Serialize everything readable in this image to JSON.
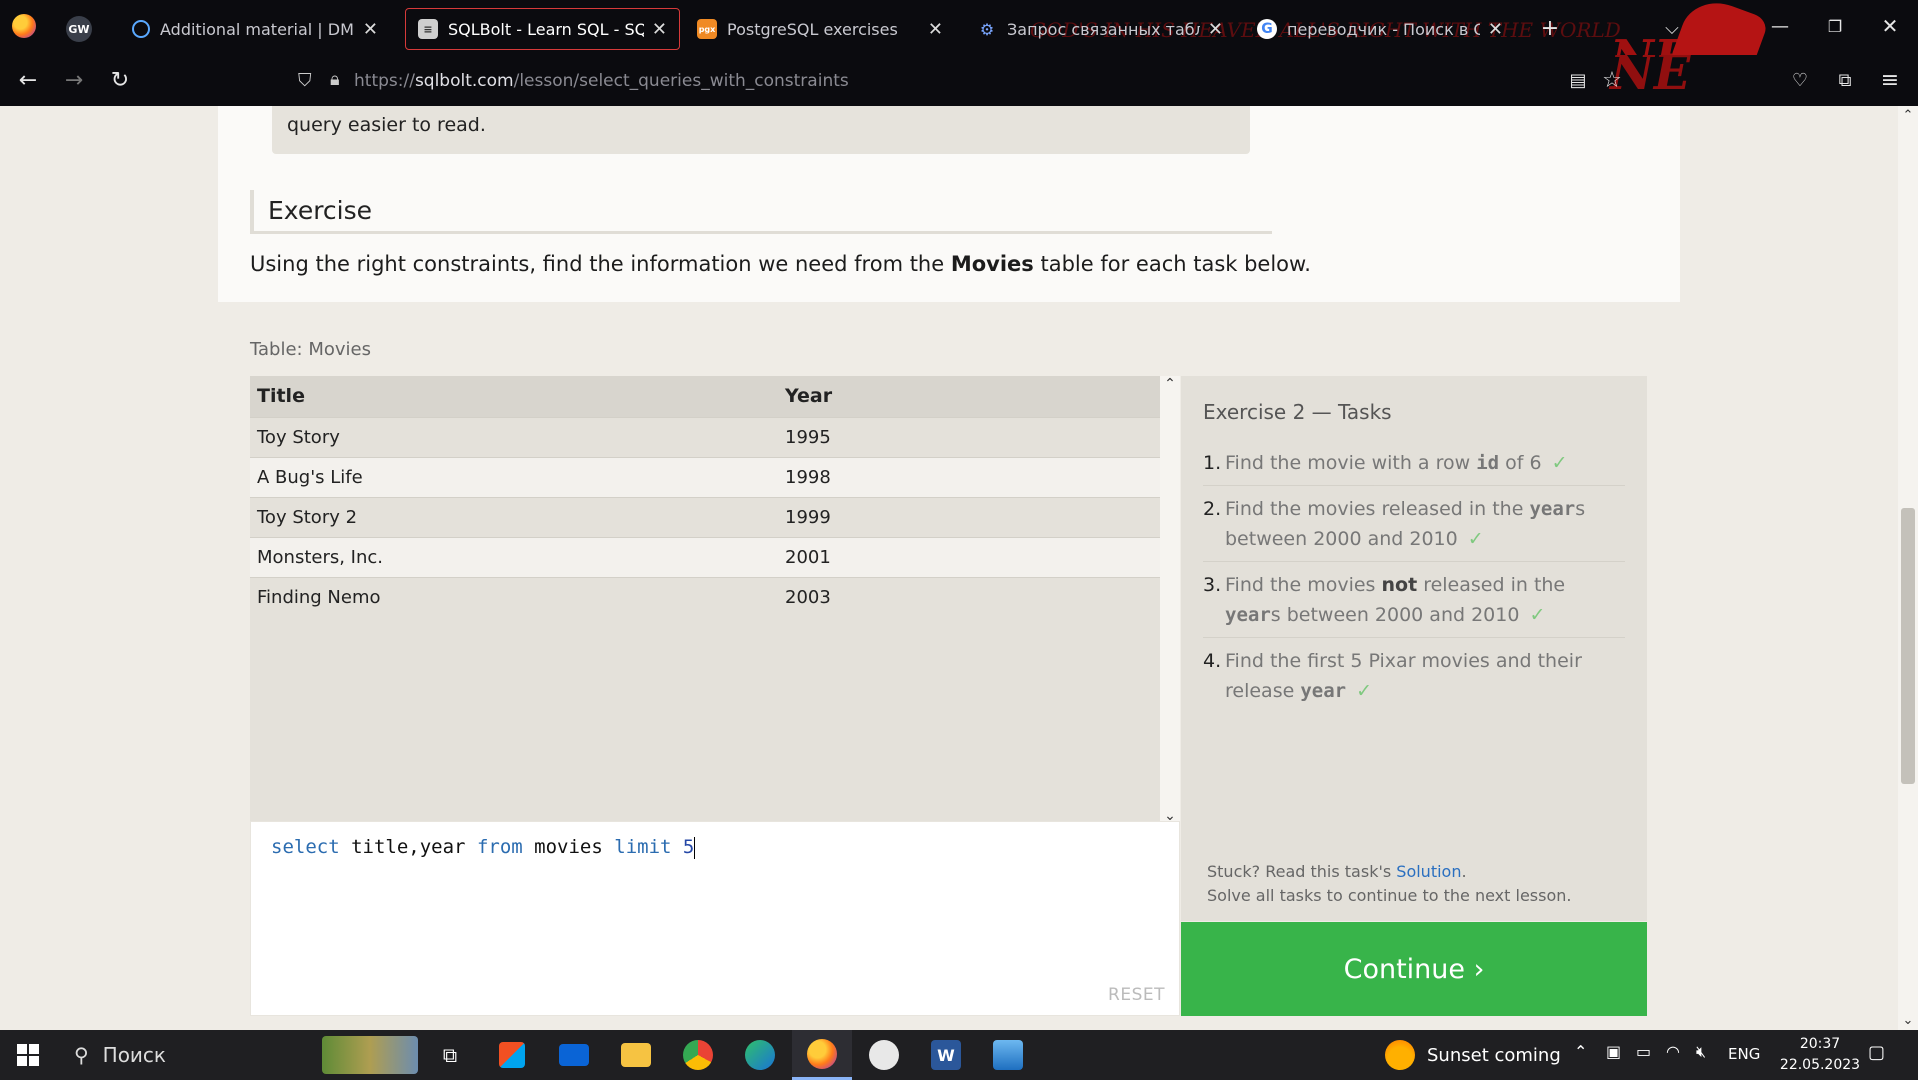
{
  "browser": {
    "pinned_tab_label": "GW",
    "tabs": [
      {
        "title": "Additional material | DML: SELE",
        "favicon": "circle-outline-icon",
        "active": false
      },
      {
        "title": "SQLBolt - Learn SQL - SQL Lesso",
        "favicon": "database-icon",
        "active": true
      },
      {
        "title": "PostgreSQL exercises",
        "favicon": "pgx-icon",
        "active": false
      },
      {
        "title": "Запрос связанных таблиц - Р",
        "favicon": "nodes-icon",
        "active": false
      },
      {
        "title": "переводчик - Поиск в Google",
        "favicon": "google-icon",
        "active": false
      }
    ],
    "url_scheme": "https://",
    "url_host": "sqlbolt.com",
    "url_path": "/lesson/select_queries_with_constraints",
    "theme_text_1": "GOD'S IN HIS HEAVEN ALL'S RIGHT WITH THE WORLD",
    "theme_text_2": "NE",
    "accent_color": "#d63a3a"
  },
  "page": {
    "note_text": "query easier to read.",
    "exercise_heading": "Exercise",
    "exercise_desc_before": "Using the right constraints, find the information we need from the ",
    "exercise_desc_bold": "Movies",
    "exercise_desc_after": " table for each task below.",
    "table_caption": "Table: Movies",
    "table": {
      "headers": [
        "Title",
        "Year"
      ],
      "rows": [
        [
          "Toy Story",
          "1995"
        ],
        [
          "A Bug's Life",
          "1998"
        ],
        [
          "Toy Story 2",
          "1999"
        ],
        [
          "Monsters, Inc.",
          "2001"
        ],
        [
          "Finding Nemo",
          "2003"
        ]
      ]
    },
    "query": {
      "kw_select": "select",
      "cols": "title,year",
      "kw_from": "from",
      "table": "movies",
      "kw_limit": "limit",
      "limit_value": "5"
    },
    "reset_label": "RESET",
    "tasks_title": "Exercise 2 — Tasks",
    "tasks": [
      {
        "num": "1.",
        "check": "✓"
      },
      {
        "num": "2.",
        "check": "✓"
      },
      {
        "num": "3.",
        "check": "✓"
      },
      {
        "num": "4.",
        "check": "✓"
      }
    ],
    "task1": {
      "a": "Find the movie with a row ",
      "code": "id",
      "b": " of 6"
    },
    "task2": {
      "a": "Find the movies released in the ",
      "code": "year",
      "b": "s between 2000 and 2010"
    },
    "task3": {
      "a": "Find the movies ",
      "bold": "not",
      "b": " released in the ",
      "code": "year",
      "c": "s between 2000 and 2010"
    },
    "task4": {
      "a": "Find the first 5 Pixar movies and their release ",
      "code": "year"
    },
    "stuck_text": "Stuck? Read this task's ",
    "solution_link": "Solution",
    "stuck_period": ".",
    "solve_all_text": "Solve all tasks to continue to the next lesson.",
    "continue_label": "Continue ›",
    "continue_color": "#38b44a"
  },
  "taskbar": {
    "search_placeholder": "Поиск",
    "weather_text": "Sunset coming",
    "language": "ENG",
    "time": "20:37",
    "date": "22.05.2023"
  }
}
